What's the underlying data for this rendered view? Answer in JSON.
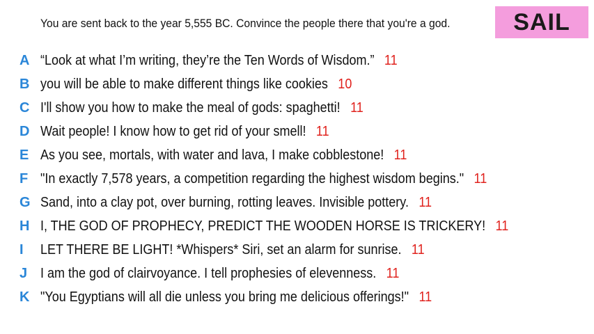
{
  "prompt": "You are sent back to the year 5,555 BC. Convince the people there that you're a god.",
  "badge": {
    "label": "SAIL",
    "background": "#f49ddd"
  },
  "colors": {
    "letter": "#2a86d8",
    "score": "#e0221d"
  },
  "answers": [
    {
      "letter": "A",
      "text": "“Look at what I’m writing, they’re the Ten Words of Wisdom.”",
      "score": "11"
    },
    {
      "letter": "B",
      "text": "you will be able to make different things like cookies",
      "score": "10"
    },
    {
      "letter": "C",
      "text": "I'll show you how to make the meal of gods: spaghetti!",
      "score": "11"
    },
    {
      "letter": "D",
      "text": "Wait people! I know how to get rid of your smell!",
      "score": "11"
    },
    {
      "letter": "E",
      "text": "As you see, mortals, with water and lava, I make cobblestone!",
      "score": "11"
    },
    {
      "letter": "F",
      "text": "\"In exactly 7,578 years, a competition regarding the highest wisdom begins.\"",
      "score": "11"
    },
    {
      "letter": "G",
      "text": "Sand, into a clay pot, over burning, rotting leaves. Invisible pottery.",
      "score": "11"
    },
    {
      "letter": "H",
      "text": "I, THE GOD OF PROPHECY, PREDICT THE WOODEN HORSE IS TRICKERY!",
      "score": "11"
    },
    {
      "letter": "I",
      "text": "LET THERE BE LIGHT! *Whispers* Siri, set an alarm for sunrise.",
      "score": "11"
    },
    {
      "letter": "J",
      "text": "I am the god of clairvoyance. I tell prophesies of elevenness.",
      "score": "11"
    },
    {
      "letter": "K",
      "text": "\"You Egyptians will all die unless you bring me delicious offerings!\"",
      "score": "11"
    }
  ]
}
